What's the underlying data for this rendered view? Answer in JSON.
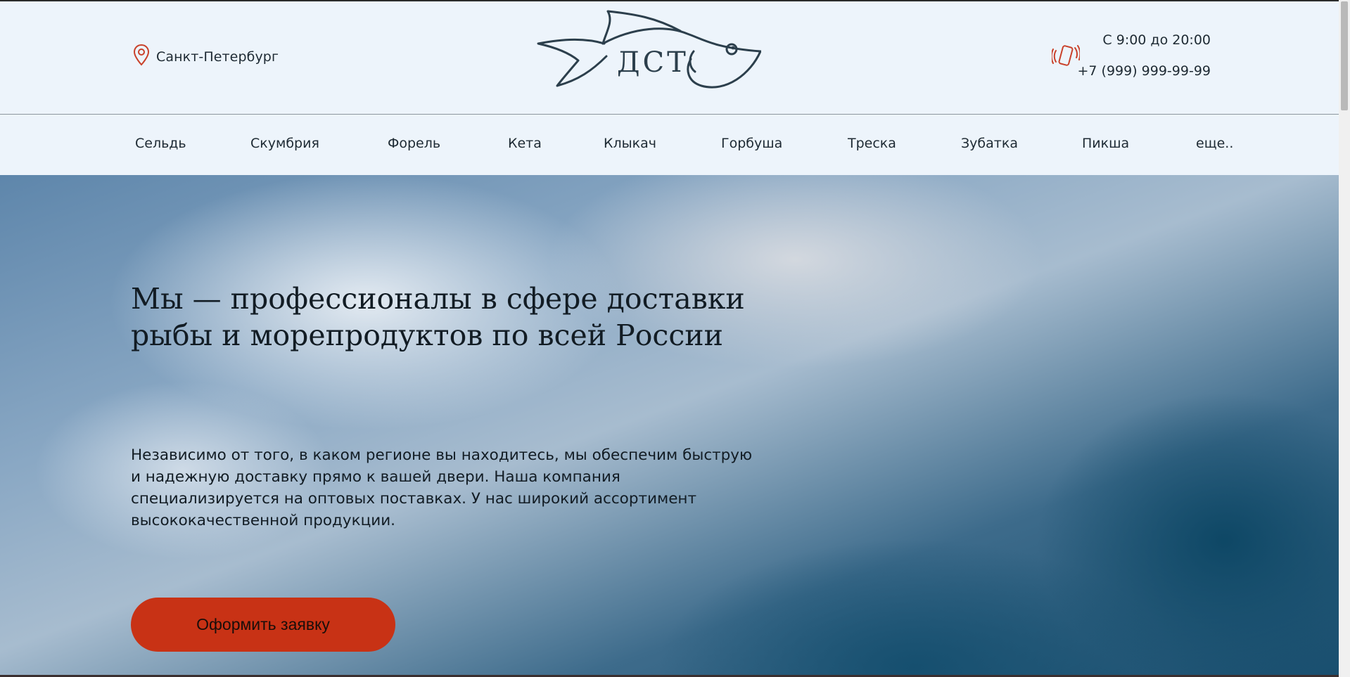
{
  "header": {
    "city": "Санкт-Петербург",
    "logo_text": "ДСТ",
    "hours": "С 9:00 до 20:00",
    "phone": "+7 (999) 999-99-99"
  },
  "nav": {
    "items": [
      {
        "label": "Сельдь"
      },
      {
        "label": "Скумбрия"
      },
      {
        "label": "Форель"
      },
      {
        "label": "Кета"
      },
      {
        "label": "Клыкач"
      },
      {
        "label": "Горбуша"
      },
      {
        "label": "Треска"
      },
      {
        "label": "Зубатка"
      },
      {
        "label": "Пикша"
      },
      {
        "label": "еще.."
      }
    ]
  },
  "hero": {
    "title_line1": "Мы — профессионалы в сфере доставки",
    "title_line2": "рыбы и морепродуктов по всей России",
    "text": "Независимо от того, в каком регионе вы находитесь, мы обеспечим быструю и надежную доставку прямо к вашей двери. Наша компания специализируется на оптовых поставках. У нас широкий ассортимент высококачественной продукции.",
    "cta_label": "Оформить заявку"
  },
  "colors": {
    "accent": "#c83215",
    "header_bg": "#edf4fb",
    "logo_stroke": "#2c3f4c",
    "text": "#121c24"
  },
  "icons": {
    "city": "location-pin-icon",
    "phone": "ringing-phone-icon"
  }
}
